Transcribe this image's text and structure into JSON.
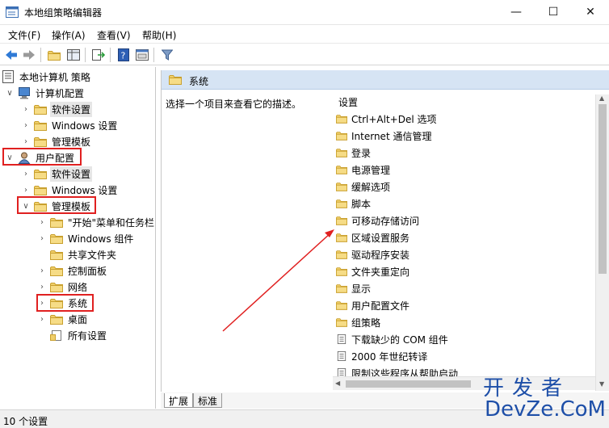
{
  "window": {
    "title": "本地组策略编辑器",
    "minimize": "—",
    "maximize": "☐",
    "close": "✕"
  },
  "menu": [
    "文件(F)",
    "操作(A)",
    "查看(V)",
    "帮助(H)"
  ],
  "tree": {
    "root": "本地计算机 策略",
    "computer_config": "计算机配置",
    "cc_software": "软件设置",
    "cc_windows": "Windows 设置",
    "cc_admin": "管理模板",
    "user_config": "用户配置",
    "uc_software": "软件设置",
    "uc_windows": "Windows 设置",
    "uc_admin": "管理模板",
    "start_menu": "\"开始\"菜单和任务栏",
    "win_components": "Windows 组件",
    "shared_folders": "共享文件夹",
    "control_panel": "控制面板",
    "network": "网络",
    "system": "系统",
    "desktop": "桌面",
    "all_settings": "所有设置"
  },
  "right_pane": {
    "header": "系统",
    "description": "选择一个项目来查看它的描述。",
    "column_header": "设置",
    "items": [
      {
        "label": "Ctrl+Alt+Del 选项",
        "type": "folder"
      },
      {
        "label": "Internet 通信管理",
        "type": "folder"
      },
      {
        "label": "登录",
        "type": "folder"
      },
      {
        "label": "电源管理",
        "type": "folder"
      },
      {
        "label": "缓解选项",
        "type": "folder"
      },
      {
        "label": "脚本",
        "type": "folder"
      },
      {
        "label": "可移动存储访问",
        "type": "folder"
      },
      {
        "label": "区域设置服务",
        "type": "folder"
      },
      {
        "label": "驱动程序安装",
        "type": "folder"
      },
      {
        "label": "文件夹重定向",
        "type": "folder"
      },
      {
        "label": "显示",
        "type": "folder"
      },
      {
        "label": "用户配置文件",
        "type": "folder"
      },
      {
        "label": "组策略",
        "type": "folder"
      },
      {
        "label": "下载缺少的 COM 组件",
        "type": "setting"
      },
      {
        "label": "2000 年世纪转译",
        "type": "setting"
      },
      {
        "label": "限制这些程序从帮助启动",
        "type": "setting"
      }
    ]
  },
  "tabs": [
    "扩展",
    "标准"
  ],
  "status": "10 个设置",
  "watermark": {
    "cn": "开发者",
    "en": "DevZe.CoM"
  },
  "colors": {
    "highlight_box": "#e02020",
    "header_bg": "#d6e4f4",
    "folder": "#e8c04a"
  }
}
